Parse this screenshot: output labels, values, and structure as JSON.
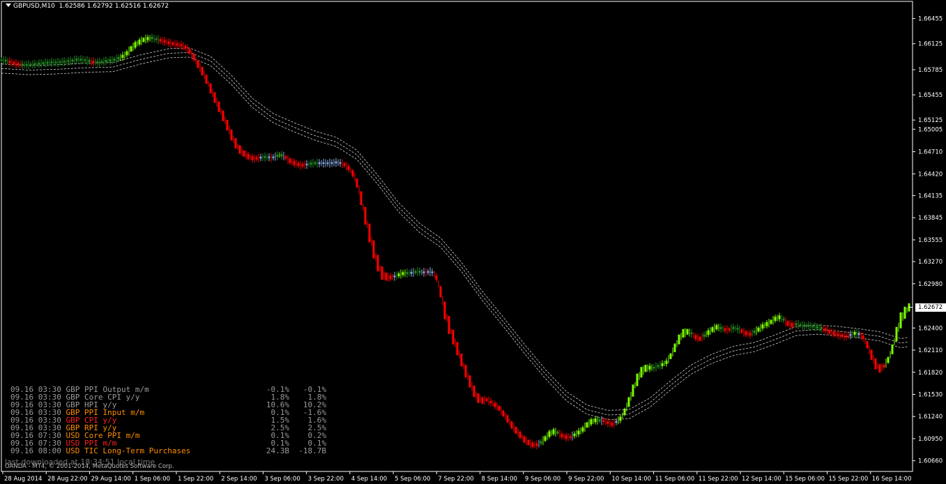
{
  "header": {
    "symbol": "GBPUSD,M10",
    "open": "1.62586",
    "high": "1.62792",
    "low": "1.62516",
    "close": "1.62672"
  },
  "current_price": "1.62672",
  "news": [
    {
      "date": "09.16",
      "time": "03:30",
      "currency": "GBP",
      "event": "PPI Output m/m",
      "actual": "-0.1%",
      "forecast": "-0.1%",
      "color": "#9a9a9a"
    },
    {
      "date": "09.16",
      "time": "03:30",
      "currency": "GBP",
      "event": "Core CPI y/y",
      "actual": "1.8%",
      "forecast": "1.8%",
      "color": "#9a9a9a"
    },
    {
      "date": "09.16",
      "time": "03:30",
      "currency": "GBP",
      "event": "HPI y/y",
      "actual": "10.6%",
      "forecast": "10.2%",
      "color": "#9a9a9a"
    },
    {
      "date": "09.16",
      "time": "03:30",
      "currency": "GBP",
      "event": "PPI Input m/m",
      "actual": "0.1%",
      "forecast": "-1.6%",
      "color": "#ff8c00"
    },
    {
      "date": "09.16",
      "time": "03:30",
      "currency": "GBP",
      "event": "CPI y/y",
      "actual": "1.5%",
      "forecast": "1.6%",
      "color": "#ff2020"
    },
    {
      "date": "09.16",
      "time": "03:30",
      "currency": "GBP",
      "event": "RPI y/y",
      "actual": "2.5%",
      "forecast": "2.5%",
      "color": "#ff8c00"
    },
    {
      "date": "09.16",
      "time": "07:30",
      "currency": "USD",
      "event": "Core PPI m/m",
      "actual": "0.1%",
      "forecast": "0.2%",
      "color": "#ff8c00"
    },
    {
      "date": "09.16",
      "time": "07:30",
      "currency": "USD",
      "event": "PPI m/m",
      "actual": "0.1%",
      "forecast": "0.1%",
      "color": "#ff2020"
    },
    {
      "date": "09.16",
      "time": "08:00",
      "currency": "USD",
      "event": "TIC Long-Term Purchases",
      "actual": "24.3B",
      "forecast": "-18.7B",
      "color": "#ff8c00"
    }
  ],
  "last_downloaded": "last downloaded at 18:34:51 local time",
  "copyright": "OANDA - MT4, © 2001-2014, MetaQuotes Software Corp.",
  "colors": {
    "background": "#000000",
    "axis": "#ffffff",
    "up_strong": "#7cfc00",
    "up_weak": "#228b22",
    "neutral": "#87aee6",
    "down": "#ff0000",
    "envelope": "#d0d0d0"
  },
  "chart_data": {
    "type": "line",
    "symbol": "GBPUSD",
    "timeframe": "M10",
    "y_ticks": [
      "1.66455",
      "1.66125",
      "1.65785",
      "1.65455",
      "1.65125",
      "1.65005",
      "1.64710",
      "1.64420",
      "1.64135",
      "1.63845",
      "1.63555",
      "1.63270",
      "1.62980",
      "1.62400",
      "1.62110",
      "1.61820",
      "1.61530",
      "1.61240",
      "1.60950",
      "1.60660"
    ],
    "x_ticks": [
      "28 Aug 2014",
      "28 Aug 22:00",
      "29 Aug 14:00",
      "1 Sep 06:00",
      "1 Sep 22:00",
      "2 Sep 14:00",
      "3 Sep 06:00",
      "3 Sep 22:00",
      "4 Sep 14:00",
      "5 Sep 06:00",
      "7 Sep 22:00",
      "8 Sep 14:00",
      "9 Sep 06:00",
      "9 Sep 22:00",
      "10 Sep 14:00",
      "11 Sep 06:00",
      "11 Sep 22:00",
      "12 Sep 14:00",
      "15 Sep 06:00",
      "15 Sep 22:00",
      "16 Sep 14:00"
    ],
    "ylim": [
      1.6052,
      1.6668
    ],
    "series": [
      {
        "role": "price",
        "points": [
          [
            0,
            1.6591
          ],
          [
            8,
            1.659
          ],
          [
            14,
            1.6588
          ],
          [
            22,
            1.6586
          ],
          [
            30,
            1.6585
          ],
          [
            40,
            1.6585
          ],
          [
            50,
            1.6586
          ],
          [
            60,
            1.6587
          ],
          [
            70,
            1.6588
          ],
          [
            80,
            1.6588
          ],
          [
            90,
            1.6589
          ],
          [
            100,
            1.659
          ],
          [
            110,
            1.6592
          ],
          [
            120,
            1.6591
          ],
          [
            130,
            1.6589
          ],
          [
            140,
            1.6588
          ],
          [
            150,
            1.659
          ],
          [
            160,
            1.6591
          ],
          [
            170,
            1.6594
          ],
          [
            178,
            1.6598
          ],
          [
            185,
            1.6605
          ],
          [
            192,
            1.6611
          ],
          [
            200,
            1.6616
          ],
          [
            208,
            1.6619
          ],
          [
            216,
            1.662
          ],
          [
            224,
            1.6618
          ],
          [
            232,
            1.6616
          ],
          [
            240,
            1.6614
          ],
          [
            248,
            1.6612
          ],
          [
            256,
            1.6611
          ],
          [
            262,
            1.6609
          ],
          [
            268,
            1.6605
          ],
          [
            274,
            1.6598
          ],
          [
            280,
            1.6589
          ],
          [
            286,
            1.658
          ],
          [
            292,
            1.657
          ],
          [
            298,
            1.6558
          ],
          [
            304,
            1.6546
          ],
          [
            310,
            1.6534
          ],
          [
            316,
            1.6522
          ],
          [
            322,
            1.651
          ],
          [
            328,
            1.6497
          ],
          [
            334,
            1.6485
          ],
          [
            340,
            1.6476
          ],
          [
            346,
            1.647
          ],
          [
            352,
            1.6466
          ],
          [
            358,
            1.6463
          ],
          [
            364,
            1.6462
          ],
          [
            370,
            1.6463
          ],
          [
            376,
            1.6464
          ],
          [
            382,
            1.6464
          ],
          [
            388,
            1.6463
          ],
          [
            394,
            1.6465
          ],
          [
            400,
            1.6467
          ],
          [
            406,
            1.6465
          ],
          [
            412,
            1.646
          ],
          [
            418,
            1.6457
          ],
          [
            424,
            1.6455
          ],
          [
            430,
            1.6453
          ],
          [
            436,
            1.6454
          ],
          [
            442,
            1.6455
          ],
          [
            448,
            1.6456
          ],
          [
            456,
            1.6456
          ],
          [
            464,
            1.6456
          ],
          [
            472,
            1.6456
          ],
          [
            480,
            1.6457
          ],
          [
            488,
            1.6456
          ],
          [
            494,
            1.6453
          ],
          [
            500,
            1.6448
          ],
          [
            506,
            1.644
          ],
          [
            510,
            1.643
          ],
          [
            514,
            1.6418
          ],
          [
            518,
            1.6402
          ],
          [
            522,
            1.6387
          ],
          [
            526,
            1.6372
          ],
          [
            530,
            1.6357
          ],
          [
            534,
            1.6343
          ],
          [
            538,
            1.633
          ],
          [
            542,
            1.632
          ],
          [
            546,
            1.6312
          ],
          [
            550,
            1.6308
          ],
          [
            556,
            1.6306
          ],
          [
            562,
            1.6307
          ],
          [
            568,
            1.6309
          ],
          [
            574,
            1.6311
          ],
          [
            580,
            1.6312
          ],
          [
            586,
            1.6312
          ],
          [
            592,
            1.6313
          ],
          [
            598,
            1.6314
          ],
          [
            604,
            1.6313
          ],
          [
            610,
            1.6313
          ],
          [
            616,
            1.6314
          ],
          [
            620,
            1.6312
          ],
          [
            624,
            1.6306
          ],
          [
            628,
            1.6295
          ],
          [
            632,
            1.628
          ],
          [
            636,
            1.6263
          ],
          [
            640,
            1.625
          ],
          [
            644,
            1.6238
          ],
          [
            648,
            1.6228
          ],
          [
            652,
            1.6218
          ],
          [
            656,
            1.6208
          ],
          [
            660,
            1.6198
          ],
          [
            664,
            1.6188
          ],
          [
            668,
            1.6179
          ],
          [
            672,
            1.617
          ],
          [
            676,
            1.6161
          ],
          [
            680,
            1.6153
          ],
          [
            684,
            1.6148
          ],
          [
            690,
            1.6145
          ],
          [
            696,
            1.6146
          ],
          [
            702,
            1.6143
          ],
          [
            708,
            1.6139
          ],
          [
            714,
            1.6135
          ],
          [
            720,
            1.6128
          ],
          [
            726,
            1.6121
          ],
          [
            732,
            1.6113
          ],
          [
            738,
            1.6106
          ],
          [
            744,
            1.61
          ],
          [
            750,
            1.6094
          ],
          [
            756,
            1.609
          ],
          [
            762,
            1.6087
          ],
          [
            768,
            1.6087
          ],
          [
            774,
            1.609
          ],
          [
            780,
            1.6095
          ],
          [
            786,
            1.6101
          ],
          [
            792,
            1.6104
          ],
          [
            798,
            1.6103
          ],
          [
            804,
            1.6099
          ],
          [
            810,
            1.6097
          ],
          [
            816,
            1.6097
          ],
          [
            822,
            1.61
          ],
          [
            828,
            1.6103
          ],
          [
            834,
            1.6107
          ],
          [
            840,
            1.6113
          ],
          [
            846,
            1.6117
          ],
          [
            852,
            1.6119
          ],
          [
            858,
            1.6119
          ],
          [
            864,
            1.6118
          ],
          [
            870,
            1.6116
          ],
          [
            876,
            1.6114
          ],
          [
            882,
            1.6117
          ],
          [
            888,
            1.6121
          ],
          [
            894,
            1.613
          ],
          [
            900,
            1.6143
          ],
          [
            906,
            1.6158
          ],
          [
            912,
            1.6172
          ],
          [
            918,
            1.6182
          ],
          [
            924,
            1.6187
          ],
          [
            930,
            1.6188
          ],
          [
            936,
            1.6188
          ],
          [
            942,
            1.619
          ],
          [
            948,
            1.6192
          ],
          [
            954,
            1.6195
          ],
          [
            960,
            1.6203
          ],
          [
            966,
            1.6214
          ],
          [
            972,
            1.6225
          ],
          [
            978,
            1.6233
          ],
          [
            984,
            1.6235
          ],
          [
            990,
            1.6233
          ],
          [
            996,
            1.6228
          ],
          [
            1002,
            1.6226
          ],
          [
            1008,
            1.623
          ],
          [
            1014,
            1.6234
          ],
          [
            1020,
            1.6238
          ],
          [
            1026,
            1.6241
          ],
          [
            1032,
            1.624
          ],
          [
            1038,
            1.6238
          ],
          [
            1044,
            1.6238
          ],
          [
            1050,
            1.624
          ],
          [
            1056,
            1.6239
          ],
          [
            1062,
            1.6236
          ],
          [
            1068,
            1.6233
          ],
          [
            1074,
            1.6232
          ],
          [
            1080,
            1.6235
          ],
          [
            1086,
            1.6238
          ],
          [
            1092,
            1.6242
          ],
          [
            1098,
            1.6245
          ],
          [
            1104,
            1.6248
          ],
          [
            1110,
            1.6252
          ],
          [
            1116,
            1.6254
          ],
          [
            1122,
            1.6251
          ],
          [
            1128,
            1.6246
          ],
          [
            1134,
            1.6244
          ],
          [
            1140,
            1.6245
          ],
          [
            1146,
            1.6244
          ],
          [
            1152,
            1.6243
          ],
          [
            1158,
            1.6243
          ],
          [
            1164,
            1.6242
          ],
          [
            1170,
            1.6241
          ],
          [
            1176,
            1.624
          ],
          [
            1182,
            1.6238
          ],
          [
            1188,
            1.6235
          ],
          [
            1194,
            1.6233
          ],
          [
            1200,
            1.6231
          ],
          [
            1206,
            1.623
          ],
          [
            1212,
            1.6229
          ],
          [
            1218,
            1.6231
          ],
          [
            1224,
            1.6233
          ],
          [
            1230,
            1.6232
          ],
          [
            1236,
            1.6228
          ],
          [
            1242,
            1.6218
          ],
          [
            1248,
            1.6205
          ],
          [
            1254,
            1.6193
          ],
          [
            1260,
            1.6187
          ],
          [
            1266,
            1.619
          ],
          [
            1272,
            1.6198
          ],
          [
            1278,
            1.6212
          ],
          [
            1284,
            1.6232
          ],
          [
            1290,
            1.625
          ],
          [
            1296,
            1.626
          ],
          [
            1302,
            1.6267
          ]
        ]
      },
      {
        "role": "envelope",
        "points": [
          [
            0,
            1.658
          ],
          [
            40,
            1.6578
          ],
          [
            80,
            1.6579
          ],
          [
            120,
            1.6581
          ],
          [
            160,
            1.6582
          ],
          [
            200,
            1.6592
          ],
          [
            240,
            1.66
          ],
          [
            270,
            1.6601
          ],
          [
            300,
            1.659
          ],
          [
            330,
            1.6565
          ],
          [
            360,
            1.6535
          ],
          [
            390,
            1.6515
          ],
          [
            420,
            1.6503
          ],
          [
            450,
            1.6492
          ],
          [
            480,
            1.6484
          ],
          [
            510,
            1.6467
          ],
          [
            540,
            1.6434
          ],
          [
            570,
            1.6398
          ],
          [
            600,
            1.6371
          ],
          [
            630,
            1.6352
          ],
          [
            660,
            1.632
          ],
          [
            690,
            1.6282
          ],
          [
            720,
            1.6248
          ],
          [
            750,
            1.6213
          ],
          [
            780,
            1.618
          ],
          [
            810,
            1.6151
          ],
          [
            840,
            1.6133
          ],
          [
            870,
            1.6126
          ],
          [
            900,
            1.6127
          ],
          [
            930,
            1.6142
          ],
          [
            960,
            1.6165
          ],
          [
            990,
            1.6186
          ],
          [
            1020,
            1.62
          ],
          [
            1050,
            1.621
          ],
          [
            1080,
            1.6215
          ],
          [
            1110,
            1.6225
          ],
          [
            1140,
            1.6236
          ],
          [
            1170,
            1.6238
          ],
          [
            1200,
            1.6236
          ],
          [
            1230,
            1.6233
          ],
          [
            1260,
            1.6229
          ],
          [
            1290,
            1.622
          ],
          [
            1302,
            1.6222
          ]
        ]
      }
    ]
  }
}
